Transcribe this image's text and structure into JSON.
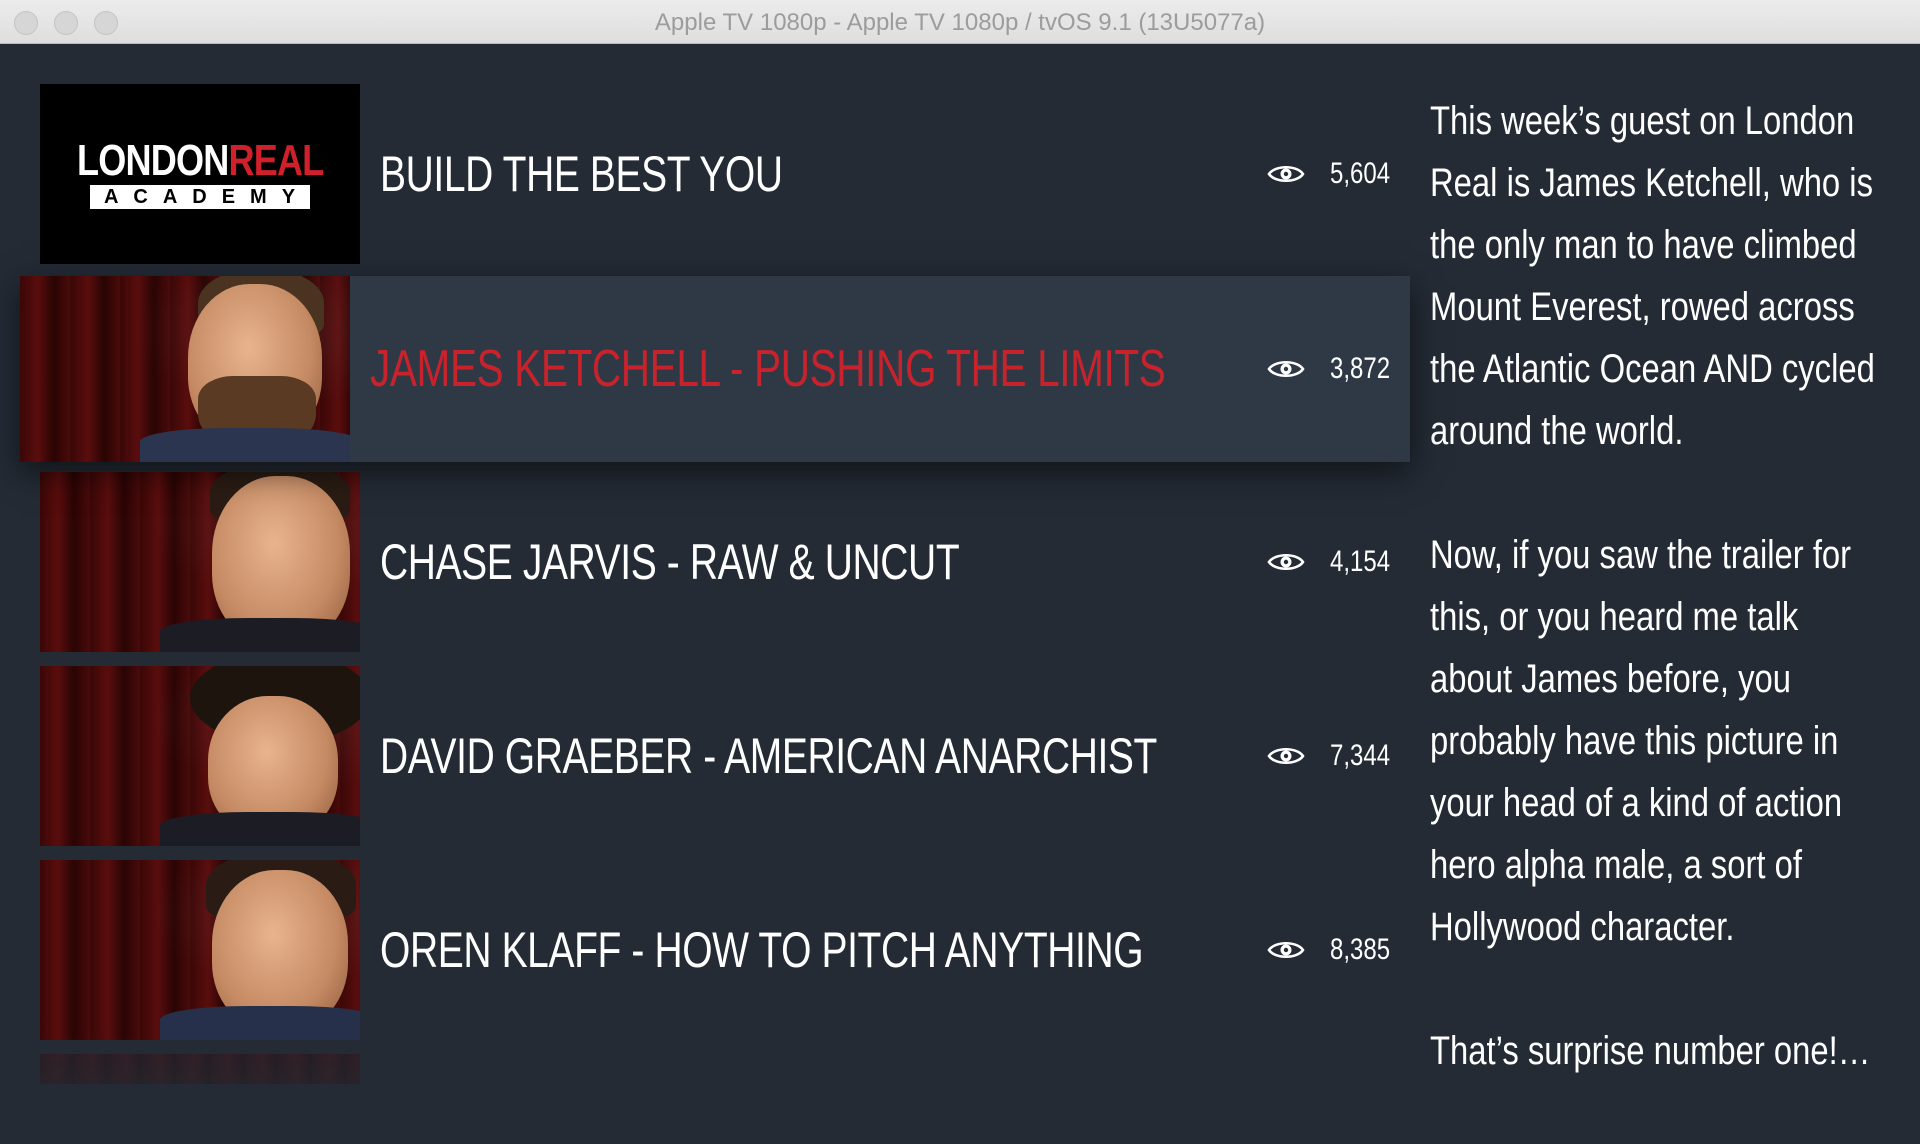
{
  "window": {
    "title": "Apple TV 1080p - Apple TV 1080p / tvOS 9.1 (13U5077a)"
  },
  "logo": {
    "line1_white": "LONDON",
    "line1_red": "REAL",
    "line2": "ACADEMY"
  },
  "videos": [
    {
      "title": "BUILD THE BEST YOU",
      "views": "5,604",
      "thumbnail": "london-real-academy-logo",
      "focused": false
    },
    {
      "title": "JAMES KETCHELL - PUSHING THE LIMITS",
      "views": "3,872",
      "thumbnail": "james-ketchell-portrait",
      "focused": true
    },
    {
      "title": "CHASE JARVIS - RAW & UNCUT",
      "views": "4,154",
      "thumbnail": "chase-jarvis-portrait",
      "focused": false
    },
    {
      "title": "DAVID GRAEBER - AMERICAN ANARCHIST",
      "views": "7,344",
      "thumbnail": "david-graeber-portrait",
      "focused": false
    },
    {
      "title": "OREN KLAFF - HOW TO PITCH ANYTHING",
      "views": "8,385",
      "thumbnail": "oren-klaff-portrait",
      "focused": false
    }
  ],
  "description": {
    "paragraphs": [
      "This week’s guest on London Real is James Ketchell, who is the only man to have climbed Mount Everest, rowed across the Atlantic Ocean AND cycled around the world.",
      "Now, if you saw the trailer for this, or you heard me talk about James before, you probably have this picture in your head of a kind of action hero alpha male, a sort of Hollywood character.",
      "That’s surprise number one!…"
    ]
  },
  "colors": {
    "background": "#242b35",
    "focused_row": "#2f3945",
    "focused_title": "#c8232c",
    "brand_red": "#d0202a",
    "text": "#ffffff"
  },
  "icons": {
    "views": "eye-icon"
  }
}
